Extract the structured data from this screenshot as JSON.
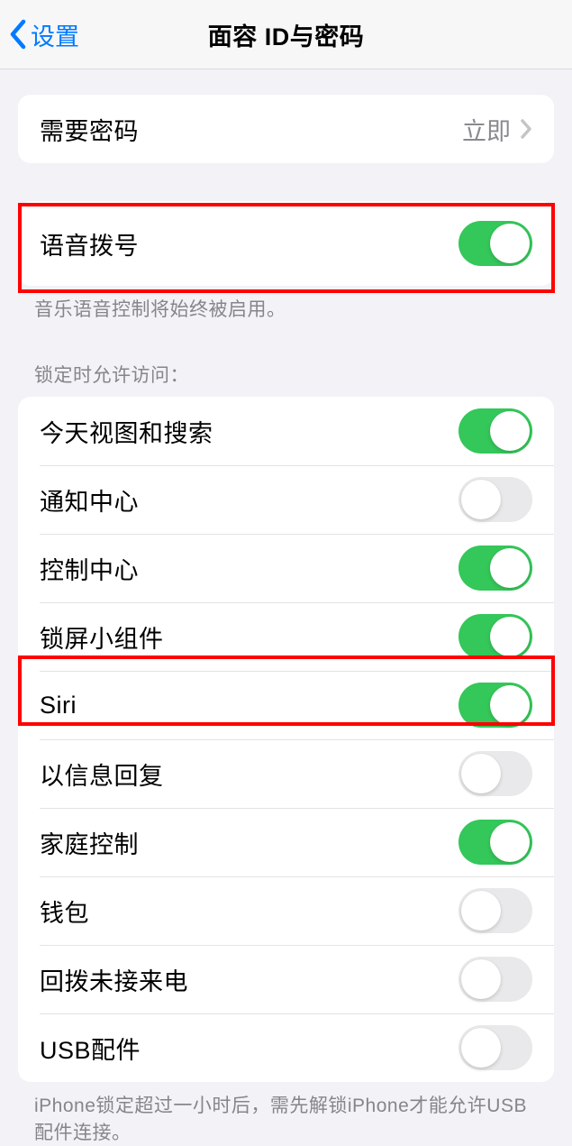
{
  "header": {
    "back_label": "设置",
    "title": "面容 ID与密码"
  },
  "passcode_row": {
    "label": "需要密码",
    "value": "立即"
  },
  "voice_dial": {
    "label": "语音拨号",
    "footer": "音乐语音控制将始终被启用。",
    "on": true
  },
  "access_section": {
    "header": "锁定时允许访问：",
    "items": [
      {
        "label": "今天视图和搜索",
        "on": true
      },
      {
        "label": "通知中心",
        "on": false
      },
      {
        "label": "控制中心",
        "on": true
      },
      {
        "label": "锁屏小组件",
        "on": true
      },
      {
        "label": "Siri",
        "on": true
      },
      {
        "label": "以信息回复",
        "on": false
      },
      {
        "label": "家庭控制",
        "on": true
      },
      {
        "label": "钱包",
        "on": false
      },
      {
        "label": "回拨未接来电",
        "on": false
      },
      {
        "label": "USB配件",
        "on": false
      }
    ],
    "footer": "iPhone锁定超过一小时后，需先解锁iPhone才能允许USB配件连接。"
  }
}
